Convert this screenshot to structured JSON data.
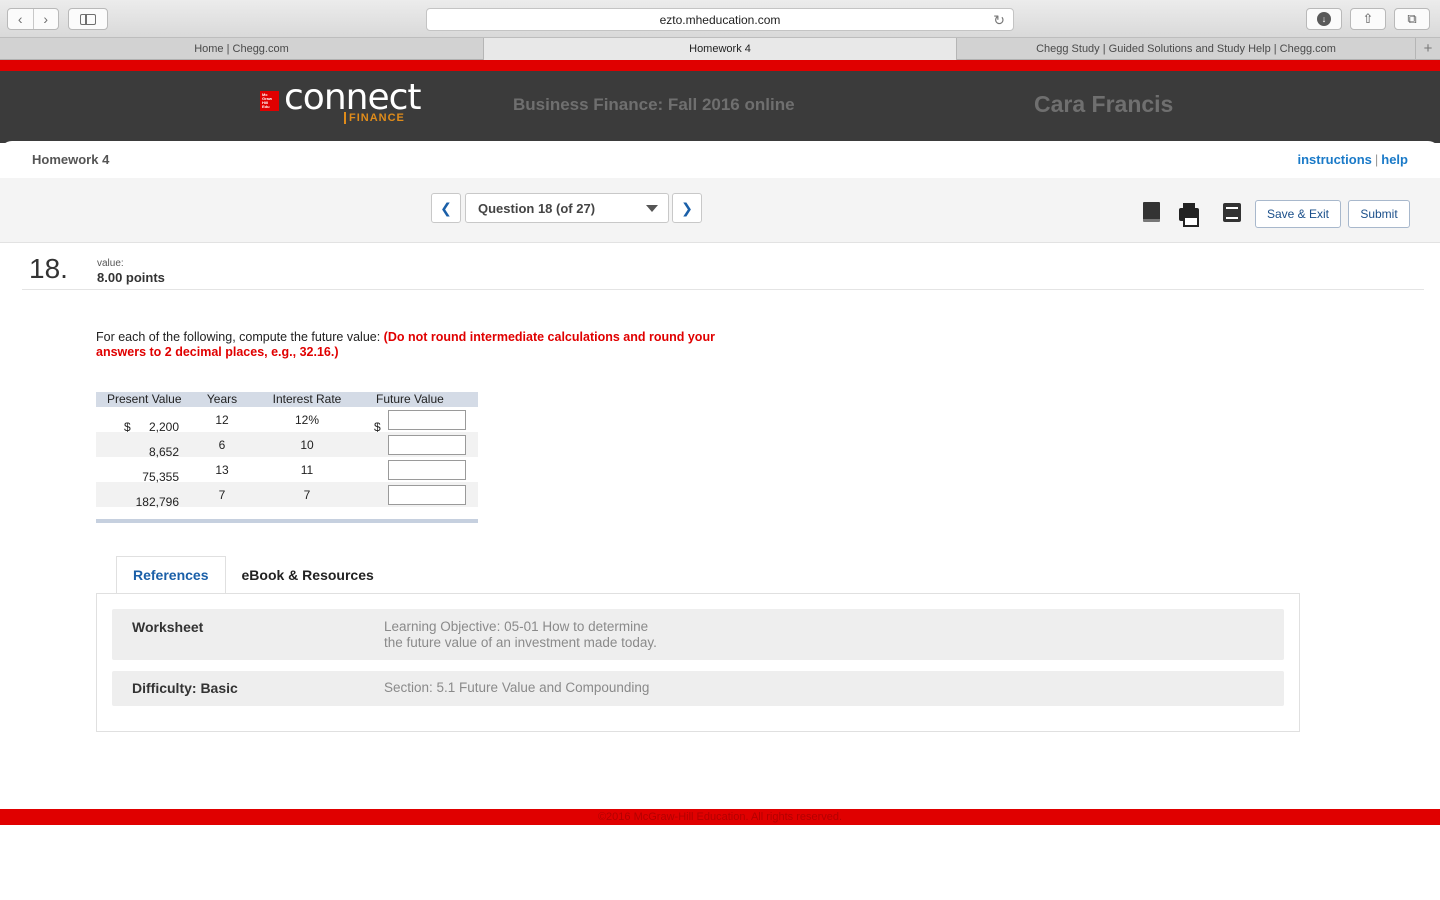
{
  "browser": {
    "url": "ezto.mheducation.com",
    "tabs": [
      {
        "label": "Home | Chegg.com"
      },
      {
        "label": "Homework 4"
      },
      {
        "label": "Chegg Study | Guided Solutions and Study Help | Chegg.com"
      }
    ],
    "icons": [
      "back-icon",
      "forward-icon",
      "sidebar-icon",
      "reload-icon",
      "download-icon",
      "share-icon",
      "tabs-overview-icon",
      "new-tab-icon"
    ]
  },
  "header": {
    "logo_text": "connect",
    "logo_sub": "FINANCE",
    "course": "Business Finance: Fall 2016 online",
    "user": "Cara Francis"
  },
  "assignment": {
    "title": "Homework 4",
    "links": {
      "instructions": "instructions",
      "help": "help"
    }
  },
  "question_nav": {
    "current": "Question 18 (of 27)",
    "save_exit": "Save & Exit",
    "submit": "Submit"
  },
  "question": {
    "number": "18.",
    "value_label": "value:",
    "points": "8.00 points",
    "prompt_plain": "For each of the following, compute the future value: ",
    "prompt_warn": "(Do not round intermediate calculations and round your answers to 2 decimal places, e.g., 32.16.)"
  },
  "table": {
    "headers": [
      "Present Value",
      "Years",
      "Interest Rate",
      "Future Value"
    ],
    "currency": "$",
    "rows": [
      {
        "pv": "2,200",
        "years": "12",
        "rate": "12%",
        "fv": ""
      },
      {
        "pv": "8,652",
        "years": "6",
        "rate": "10",
        "fv": ""
      },
      {
        "pv": "75,355",
        "years": "13",
        "rate": "11",
        "fv": ""
      },
      {
        "pv": "182,796",
        "years": "7",
        "rate": "7",
        "fv": ""
      }
    ]
  },
  "references": {
    "tabs": [
      "References",
      "eBook & Resources"
    ],
    "rows": [
      {
        "key": "Worksheet",
        "value_line1": "Learning Objective: 05-01 How to determine",
        "value_line2": "the future value of an investment made today."
      },
      {
        "key": "Difficulty: Basic",
        "value_line1": "Section: 5.1 Future Value and Compounding"
      }
    ]
  },
  "footer": "©2016 McGraw-Hill Education. All rights reserved.",
  "colors": {
    "brand_red": "#e00000",
    "header_dark": "#3b3b3b",
    "link_blue": "#1a7ac8",
    "logo_orange": "#e08c1a"
  }
}
